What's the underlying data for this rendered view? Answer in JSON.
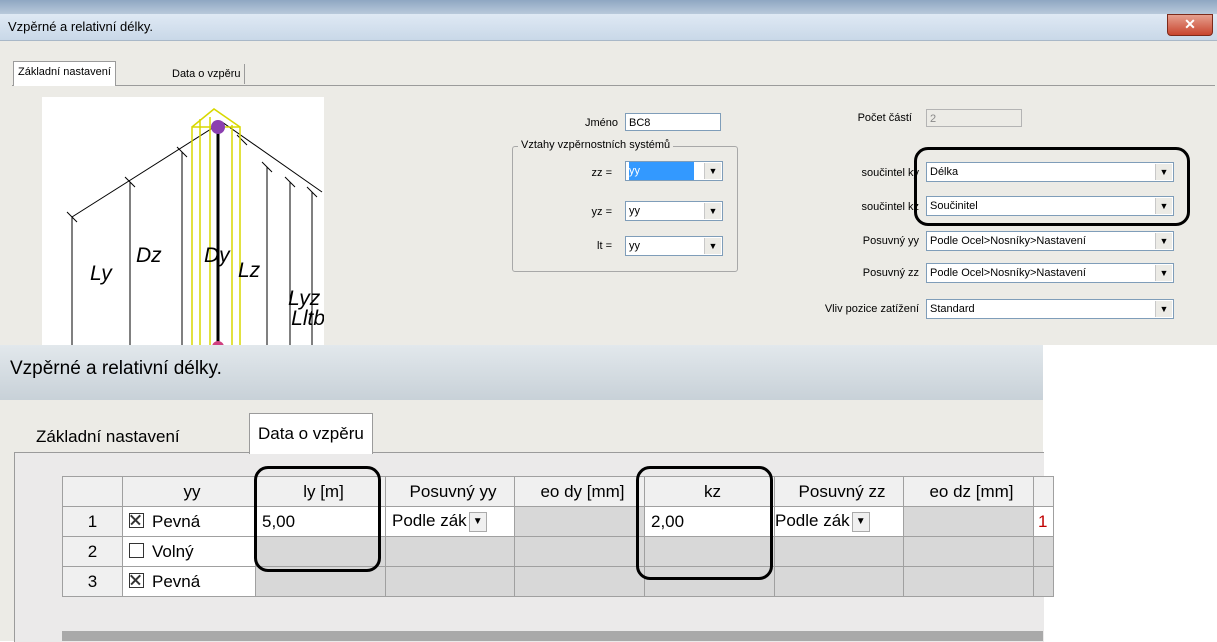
{
  "top_dialog": {
    "title": "Vzpěrné a relativní délky.",
    "close_glyph": "✕",
    "tabs": [
      "Základní nastavení",
      "Data o vzpěru"
    ],
    "diagram_labels": [
      "Ly",
      "Dz",
      "Dy",
      "Lz",
      "Lyz",
      "Lltb"
    ],
    "name": {
      "label": "Jméno",
      "value": "BC8"
    },
    "parts": {
      "label": "Počet částí",
      "value": "2"
    },
    "group": {
      "title": "Vztahy vzpěrnostních systémů",
      "rows": [
        {
          "label": "zz =",
          "value": "yy"
        },
        {
          "label": "yz =",
          "value": "yy"
        },
        {
          "label": "lt =",
          "value": "yy"
        }
      ]
    },
    "settings": [
      {
        "label": "součintel ky",
        "value": "Délka"
      },
      {
        "label": "součintel kz",
        "value": "Součinitel"
      },
      {
        "label": "Posuvný yy",
        "value": "Podle Ocel>Nosníky>Nastavení"
      },
      {
        "label": "Posuvný zz",
        "value": "Podle Ocel>Nosníky>Nastavení"
      },
      {
        "label": "Vliv pozice zatížení",
        "value": "Standard"
      }
    ]
  },
  "bottom_dialog": {
    "title": "Vzpěrné a relativní délky.",
    "tabs": [
      "Základní nastavení",
      "Data o vzpěru"
    ],
    "grid": {
      "headers": [
        "",
        "yy",
        "ly [m]",
        "Posuvný yy",
        "eo dy [mm]",
        "kz",
        "Posuvný zz",
        "eo dz [mm]",
        ""
      ],
      "rows": [
        {
          "n": "1",
          "yy": "Pevná",
          "checked": true,
          "ly": "5,00",
          "posuvny_yy": "Podle zák",
          "kz": "2,00",
          "posuvny_zz": "Podle zák",
          "extra": "1"
        },
        {
          "n": "2",
          "yy": "Volný",
          "checked": false
        },
        {
          "n": "3",
          "yy": "Pevná",
          "checked": true
        }
      ]
    },
    "dropdown_glyph": "▼"
  },
  "colors": {
    "highlight": "#3399ff",
    "dialog_bg": "#ecebe6",
    "extra_value": "#c00000"
  }
}
